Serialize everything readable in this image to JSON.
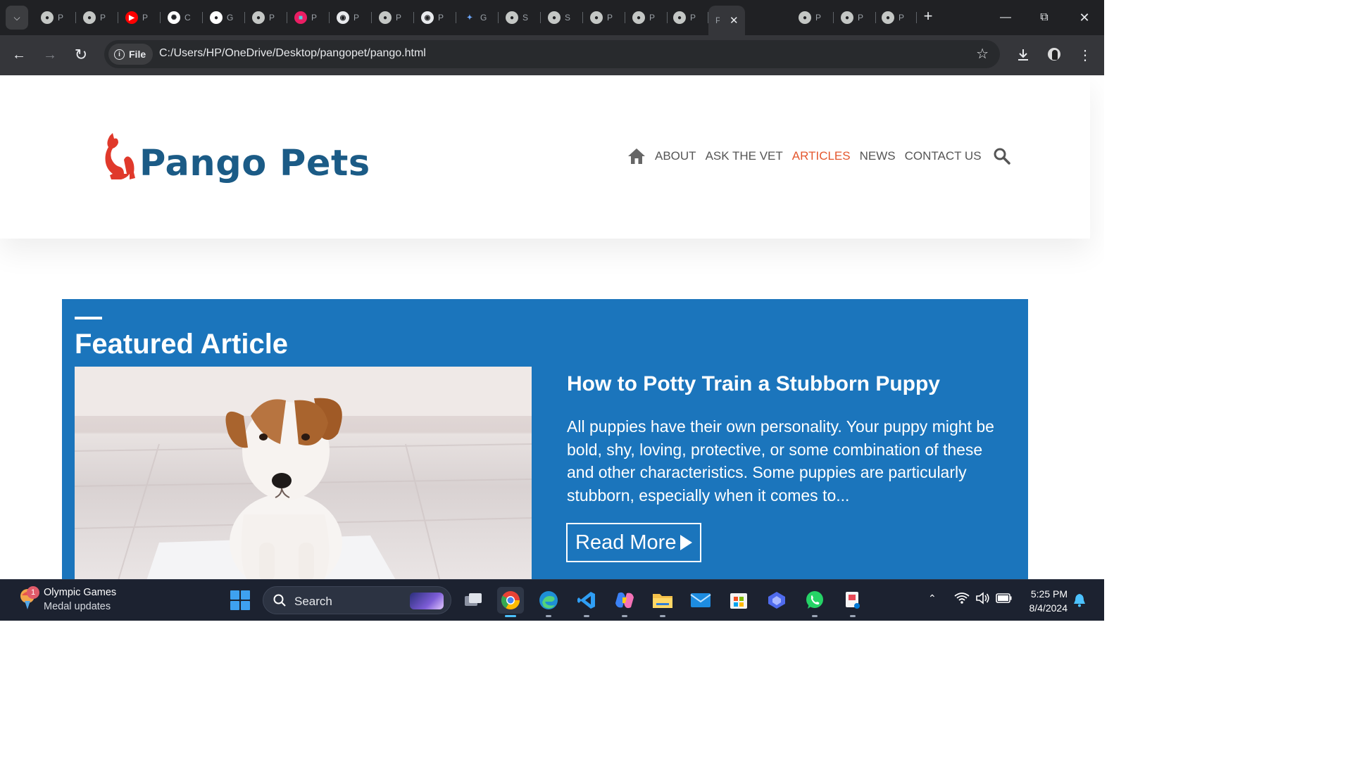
{
  "browser": {
    "tabs": [
      {
        "icon": "globe-icon",
        "text": "P"
      },
      {
        "icon": "globe-icon",
        "text": "P"
      },
      {
        "icon": "youtube-icon",
        "text": "P"
      },
      {
        "icon": "chatgpt-icon",
        "text": "C"
      },
      {
        "icon": "github-icon",
        "text": "G"
      },
      {
        "icon": "globe-icon",
        "text": "P"
      },
      {
        "icon": "app-icon",
        "text": "P"
      },
      {
        "icon": "chrome-icon",
        "text": "P"
      },
      {
        "icon": "globe-icon",
        "text": "P"
      },
      {
        "icon": "chrome-icon",
        "text": "P"
      },
      {
        "icon": "gemini-icon",
        "text": "G"
      },
      {
        "icon": "globe-icon",
        "text": "S"
      },
      {
        "icon": "globe-icon",
        "text": "S"
      },
      {
        "icon": "globe-icon",
        "text": "P"
      },
      {
        "icon": "globe-icon",
        "text": "P"
      },
      {
        "icon": "globe-icon",
        "text": "P"
      },
      {
        "icon": "globe-icon",
        "text": "P"
      },
      {
        "icon": "globe-icon",
        "text": "P"
      },
      {
        "icon": "globe-icon",
        "text": "P"
      }
    ],
    "active_tab_title": "P",
    "omnibox": {
      "chip_label": "File",
      "url": "C:/Users/HP/OneDrive/Desktop/pangopet/pango.html"
    }
  },
  "site": {
    "logo_text": "Pango Pets",
    "nav": [
      "ABOUT",
      "ASK THE VET",
      "ARTICLES",
      "NEWS",
      "CONTACT US"
    ],
    "active_nav": "ARTICLES",
    "accent_color": "#e4572e",
    "brand_color": "#1b5b86",
    "featured_bg": "#1b75bc"
  },
  "featured": {
    "section_title": "Featured Article",
    "article_title": "How to Potty Train a Stubborn Puppy",
    "excerpt": "All puppies have their own personality. Your puppy might be bold, shy, loving, protective, or some combination of these and other characteristics. Some puppies are particularly stubborn, especially when it comes to...",
    "read_more_label": "Read More",
    "image_subject": "puppy-on-floor"
  },
  "taskbar": {
    "widget_badge": "1",
    "widget_title": "Olympic Games",
    "widget_subtitle": "Medal updates",
    "search_placeholder": "Search",
    "time": "5:25 PM",
    "date": "8/4/2024"
  }
}
